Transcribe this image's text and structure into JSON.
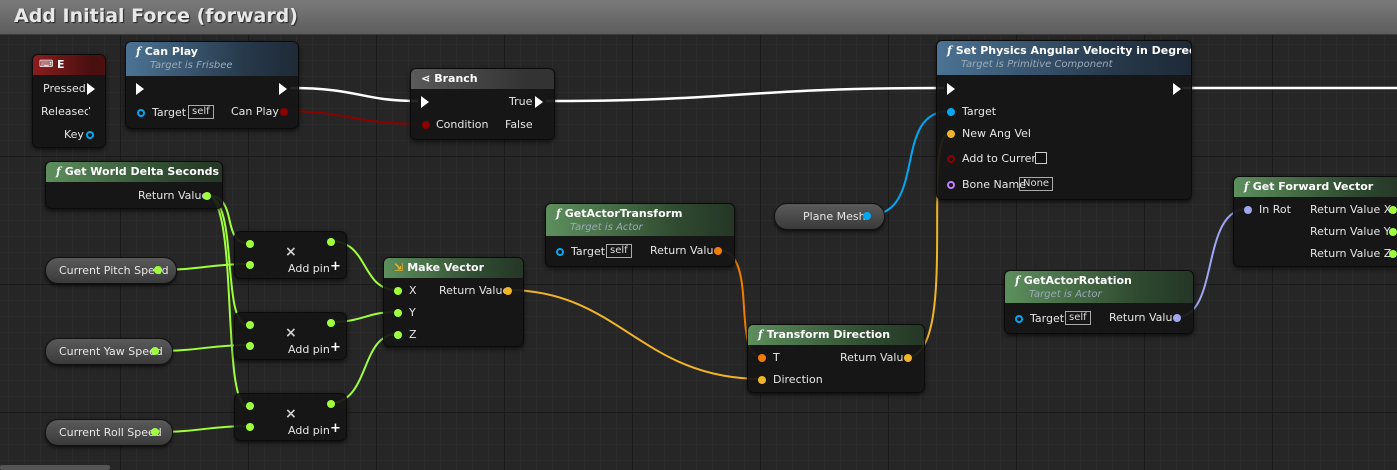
{
  "graph_title": "Add Initial Force (forward)",
  "colors": {
    "exec": "#ffffff",
    "bool": "#8c0000",
    "object": "#00a8f3",
    "vector": "#f0b429",
    "float": "#a0ff3c",
    "transform": "#f07d00",
    "rotator": "#a0a6f0"
  },
  "event_e": {
    "title": "E",
    "pins": {
      "pressed": "Pressed",
      "released": "Released",
      "key": "Key"
    }
  },
  "can_play": {
    "title": "Can Play",
    "subtitle": "Target is Frisbee",
    "target": "Target",
    "self": "self",
    "out": "Can Play"
  },
  "branch": {
    "title": "Branch",
    "condition": "Condition",
    "true": "True",
    "false": "False"
  },
  "set_phys": {
    "title": "Set Physics Angular Velocity in Degrees",
    "subtitle": "Target is Primitive Component",
    "target": "Target",
    "new_ang_vel": "New Ang Vel",
    "add_to_current": "Add to Current",
    "bone_name": "Bone Name",
    "bone_value": "None"
  },
  "get_world_delta": {
    "title": "Get World Delta Seconds",
    "ret": "Return Value"
  },
  "mult_nodes": [
    {
      "op": "×",
      "add_pin": "Add pin"
    },
    {
      "op": "×",
      "add_pin": "Add pin"
    },
    {
      "op": "×",
      "add_pin": "Add pin"
    }
  ],
  "vars": {
    "pitch": "Current Pitch Speed",
    "yaw": "Current Yaw Speed",
    "roll": "Current Roll Speed",
    "plane_mesh": "Plane Mesh"
  },
  "make_vector": {
    "title": "Make Vector",
    "x": "X",
    "y": "Y",
    "z": "Z",
    "ret": "Return Value"
  },
  "get_actor_transform": {
    "title": "GetActorTransform",
    "subtitle": "Target is Actor",
    "target": "Target",
    "self": "self",
    "ret": "Return Value"
  },
  "transform_direction": {
    "title": "Transform Direction",
    "t": "T",
    "direction": "Direction",
    "ret": "Return Value"
  },
  "get_actor_rotation": {
    "title": "GetActorRotation",
    "subtitle": "Target is Actor",
    "target": "Target",
    "self": "self",
    "ret": "Return Value"
  },
  "get_forward_vector": {
    "title": "Get Forward Vector",
    "in_rot": "In Rot",
    "x": "Return Value X",
    "y": "Return Value Y",
    "z": "Return Value Z"
  }
}
